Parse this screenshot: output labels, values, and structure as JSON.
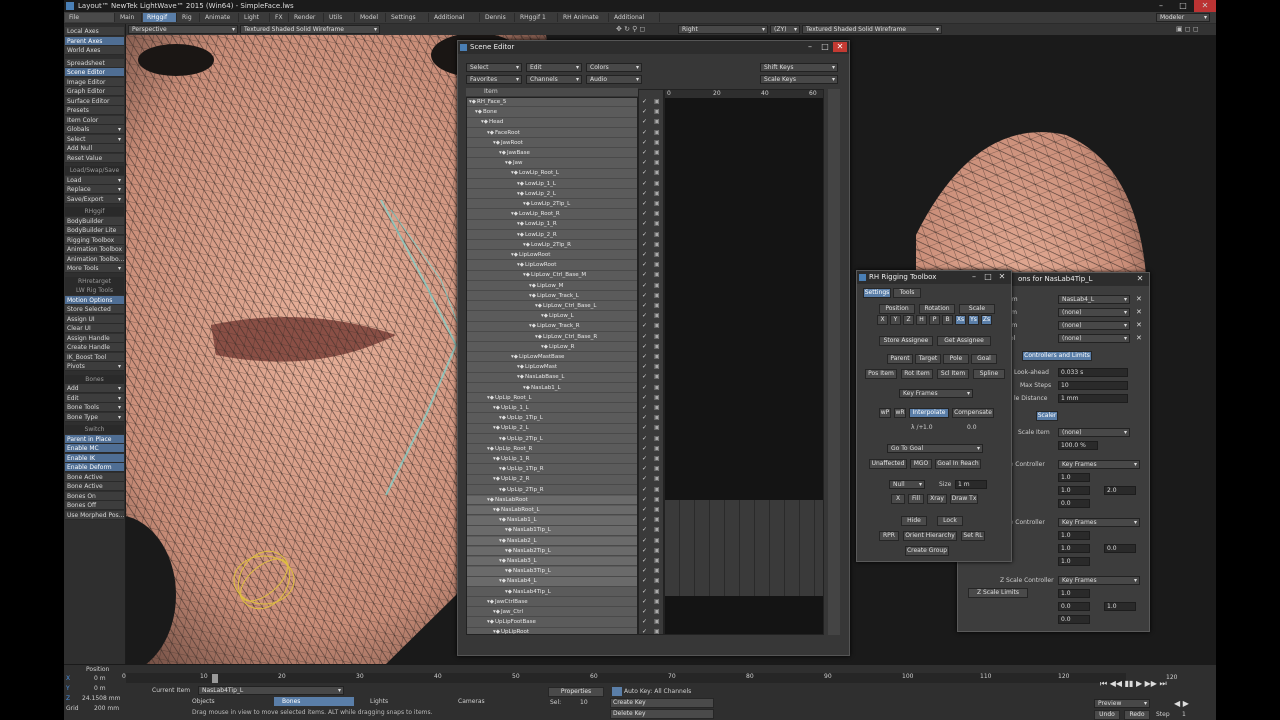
{
  "window": {
    "title": "Layout™ NewTek LightWave™ 2015 (Win64) - SimpleFace.lws",
    "modeler_btn": "Modeler"
  },
  "menu": [
    "File",
    "Main",
    "RHggif",
    "Rig",
    "Animate",
    "Light",
    "FX",
    "Render",
    "Utils",
    "Model",
    "Settings",
    "Additional",
    "Dennis",
    "RHggif 1",
    "RH Animate",
    "Additional"
  ],
  "viewport_bar": {
    "left_view": "Perspective",
    "left_shading": "Textured Shaded Solid Wireframe",
    "right_view": "Right",
    "right_axis": "(ZY)",
    "right_shading": "Textured Shaded Solid Wireframe"
  },
  "sidebar": [
    {
      "label": "Local Axes",
      "t": "n"
    },
    {
      "label": "Parent Axes",
      "t": "hl"
    },
    {
      "label": "World Axes",
      "t": "n"
    },
    {
      "label": "Spreadsheet",
      "t": "n"
    },
    {
      "label": "Scene Editor",
      "t": "hl"
    },
    {
      "label": "Image Editor",
      "t": "n"
    },
    {
      "label": "Graph Editor",
      "t": "n"
    },
    {
      "label": "Surface Editor",
      "t": "n"
    },
    {
      "label": "Presets",
      "t": "n"
    },
    {
      "label": "Item Color",
      "t": "n"
    },
    {
      "label": "Globals",
      "t": "d"
    },
    {
      "label": "Select",
      "t": "d"
    },
    {
      "label": "Add Null",
      "t": "n"
    },
    {
      "label": "Reset Value",
      "t": "n"
    },
    {
      "label": "Load/Swap/Save",
      "t": "h"
    },
    {
      "label": "Load",
      "t": "d"
    },
    {
      "label": "Replace",
      "t": "d"
    },
    {
      "label": "Save/Export",
      "t": "d"
    },
    {
      "label": "RHggif",
      "t": "h"
    },
    {
      "label": "BodyBuilder",
      "t": "n"
    },
    {
      "label": "BodyBuilder Lite",
      "t": "n"
    },
    {
      "label": "Rigging Toolbox",
      "t": "n"
    },
    {
      "label": "Animation Toolbox",
      "t": "n"
    },
    {
      "label": "Animation Toolbo...",
      "t": "n"
    },
    {
      "label": "More Tools",
      "t": "d"
    },
    {
      "label": "RHretarget",
      "t": "h"
    },
    {
      "label": "LW Rig Tools",
      "t": "h"
    },
    {
      "label": "Motion Options",
      "t": "hl"
    },
    {
      "label": "Store Selected",
      "t": "n"
    },
    {
      "label": "Assign UI",
      "t": "n"
    },
    {
      "label": "Clear UI",
      "t": "n"
    },
    {
      "label": "Assign Handle",
      "t": "n"
    },
    {
      "label": "Create Handle",
      "t": "n"
    },
    {
      "label": "IK_Boost Tool",
      "t": "n"
    },
    {
      "label": "Pivots",
      "t": "d"
    },
    {
      "label": "Bones",
      "t": "h"
    },
    {
      "label": "Add",
      "t": "d"
    },
    {
      "label": "Edit",
      "t": "d"
    },
    {
      "label": "Bone Tools",
      "t": "d"
    },
    {
      "label": "Bone Type",
      "t": "d"
    },
    {
      "label": "Switch",
      "t": "h"
    },
    {
      "label": "Parent in Place",
      "t": "hl"
    },
    {
      "label": "Enable MC",
      "t": "hl"
    },
    {
      "label": "Enable IK",
      "t": "hl"
    },
    {
      "label": "Enable Deform",
      "t": "hl"
    },
    {
      "label": "Bone Active",
      "t": "n"
    },
    {
      "label": "Bone Active",
      "t": "n"
    },
    {
      "label": "Bones On",
      "t": "n"
    },
    {
      "label": "Bones Off",
      "t": "n"
    },
    {
      "label": "Use Morphed Pos...",
      "t": "n"
    }
  ],
  "scene_editor": {
    "title": "Scene Editor",
    "dropdowns": [
      "Select",
      "Edit",
      "Colors",
      "Shift Keys",
      "Favorites",
      "Channels",
      "Audio",
      "Scale Keys"
    ],
    "col_header": "Item",
    "ruler": [
      "0",
      "20",
      "40",
      "60"
    ],
    "rows": [
      [
        "RH_Face_5",
        1
      ],
      [
        "Bone",
        2
      ],
      [
        "Head",
        3
      ],
      [
        "FaceRoot",
        4
      ],
      [
        "JawRoot",
        5
      ],
      [
        "JawBase",
        6
      ],
      [
        "Jaw",
        7
      ],
      [
        "LowLip_Root_L",
        8
      ],
      [
        "LowLip_1_L",
        9
      ],
      [
        "LowLip_2_L",
        9
      ],
      [
        "LowLip_2Tip_L",
        10
      ],
      [
        "LowLip_Root_R",
        8
      ],
      [
        "LowLip_1_R",
        9
      ],
      [
        "LowLip_2_R",
        9
      ],
      [
        "LowLip_2Tip_R",
        10
      ],
      [
        "LipLowRoot",
        8
      ],
      [
        "LipLowRoot",
        9
      ],
      [
        "LipLow_Ctrl_Base_M",
        10
      ],
      [
        "LipLow_M",
        11
      ],
      [
        "LipLow_Track_L",
        11
      ],
      [
        "LipLow_Ctrl_Base_L",
        12
      ],
      [
        "LipLow_L",
        13
      ],
      [
        "LipLow_Track_R",
        11
      ],
      [
        "LipLow_Ctrl_Base_R",
        12
      ],
      [
        "LipLow_R",
        13
      ],
      [
        "LipLowMastBase",
        8
      ],
      [
        "LipLowMast",
        9
      ],
      [
        "NasLabBase_L",
        9
      ],
      [
        "NasLab1_L",
        10
      ],
      [
        "UpLip_Root_L",
        4
      ],
      [
        "UpLip_1_L",
        5
      ],
      [
        "UpLip_1Tip_L",
        6
      ],
      [
        "UpLip_2_L",
        5
      ],
      [
        "UpLip_2Tip_L",
        6
      ],
      [
        "UpLip_Root_R",
        4
      ],
      [
        "UpLip_1_R",
        5
      ],
      [
        "UpLip_1Tip_R",
        6
      ],
      [
        "UpLip_2_R",
        5
      ],
      [
        "UpLip_2Tip_R",
        6
      ],
      [
        "NasLabRoot",
        4
      ],
      [
        "NasLabRoot_L",
        5
      ],
      [
        "NasLab1_L",
        6
      ],
      [
        "NasLab1Tip_L",
        7
      ],
      [
        "NasLab2_L",
        6
      ],
      [
        "NasLab2Tip_L",
        7
      ],
      [
        "NasLab3_L",
        6
      ],
      [
        "NasLab3Tip_L",
        7
      ],
      [
        "NasLab4_L",
        6
      ],
      [
        "NasLab4Tip_L",
        7
      ],
      [
        "JawCtrlBase",
        4
      ],
      [
        "Jaw_Ctrl",
        5
      ],
      [
        "UpLipFootBase",
        4
      ],
      [
        "UpLipRoot",
        5
      ]
    ]
  },
  "rig_toolbox": {
    "title": "RH Rigging Toolbox",
    "tabs": [
      "Settings",
      "Tools"
    ],
    "row1": [
      "Position",
      "Rotation",
      "Scale"
    ],
    "row2": [
      "X",
      "Y",
      "Z",
      "H",
      "P",
      "B",
      "Xs",
      "Ys",
      "Zs"
    ],
    "row3": [
      "Store Assignee",
      "Get Assignee"
    ],
    "row4": [
      "Parent",
      "Target",
      "Pole",
      "Goal"
    ],
    "row5": [
      "Pos Item",
      "Rot Item",
      "Scl Item",
      "Spline"
    ],
    "key_frames": "Key Frames",
    "row6": [
      "wP",
      "wR",
      "Interpolate",
      "Compensate"
    ],
    "interp_label": "λ /+",
    "interp_a": "1.0",
    "interp_b": "0.0",
    "goto": "Go To Goal",
    "row7": [
      "Unaffected",
      "MGO",
      "Goal In Reach"
    ],
    "null_dd": "Null",
    "size_label": "Size",
    "size_val": "1 m",
    "row8": [
      "X",
      "Fill",
      "Xray",
      "Draw Tx"
    ],
    "row9": [
      "Hide",
      "Lock"
    ],
    "row10": [
      "RPR",
      "Orient Hierarchy",
      "Set RL"
    ],
    "create_group": "Create Group"
  },
  "motion_options": {
    "title": "ons for NasLab4Tip_L",
    "rows": [
      [
        "Parent Item",
        "NasLab4_L"
      ],
      [
        "Target Item",
        "(none)"
      ],
      [
        "Pole Item",
        "(none)"
      ],
      [
        "Spline Control",
        "(none)"
      ]
    ],
    "tab_ctrl": "Controllers and Limits",
    "look_ahead_lbl": "Look-ahead",
    "look_ahead": "0.033 s",
    "max_steps_lbl": "Max Steps",
    "max_steps": "10",
    "distance_lbl": "le Distance",
    "distance": "1 mm",
    "tab_scale": "Scaler",
    "scale_item_lbl": "Scale Item",
    "scale_item": "(none)",
    "scale_pct": "100.0 %",
    "x_ctrl_lbl": "le Controller",
    "x_ctrl": "Key Frames",
    "y_ctrl_lbl": "le Controller",
    "y_ctrl": "Key Frames",
    "z_ctrl_lbl": "Z Scale Controller",
    "z_ctrl": "Key Frames",
    "z_limits": "Z Scale Limits",
    "vals": [
      "1.0",
      "1.0",
      "2.0",
      "0.0",
      "1.0",
      "1.0",
      "0.0",
      "1.0",
      "1.0",
      "0.0",
      "1.0",
      "0.0"
    ]
  },
  "bottom": {
    "position_label": "Position",
    "x_val": "0 m",
    "y_val": "0 m",
    "z_val": "24.1508 mm",
    "grid_val": "200 mm",
    "ticks": [
      "0",
      "10",
      "20",
      "30",
      "40",
      "50",
      "60",
      "70",
      "80",
      "90",
      "100",
      "110",
      "120"
    ],
    "current_item_lbl": "Current Item",
    "current_item": "NasLab4Tip_L",
    "objects": "Objects",
    "bones": "Bones",
    "lights": "Lights",
    "cameras": "Cameras",
    "properties": "Properties",
    "sel_lbl": "Sel:",
    "sel_val": "10",
    "autokey": "Auto Key: All Channels",
    "create_key": "Create Key",
    "delete_key": "Delete Key",
    "status": "Drag mouse in view to move selected items. ALT while dragging snaps to items.",
    "frame_0": "0",
    "frame_120": "120",
    "preview": "Preview",
    "undo": "Undo",
    "redo": "Redo",
    "step_lbl": "Step",
    "step_val": "1"
  }
}
